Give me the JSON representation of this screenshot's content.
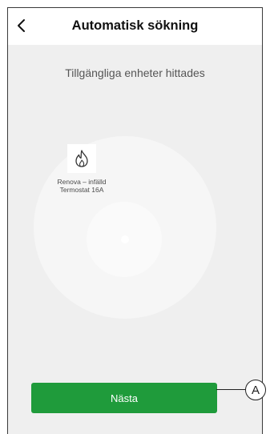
{
  "header": {
    "title": "Automatisk sökning",
    "back_icon": "chevron-left-icon"
  },
  "status": {
    "subtitle": "Tillgängliga enheter hittades"
  },
  "devices": [
    {
      "name_line1": "Renova – infälld",
      "name_line2": "Termostat 16A",
      "icon": "flame-icon"
    }
  ],
  "footer": {
    "next_label": "Nästa"
  },
  "callout": {
    "label": "A"
  },
  "colors": {
    "accent": "#1f9b3b",
    "background": "#efefef"
  }
}
